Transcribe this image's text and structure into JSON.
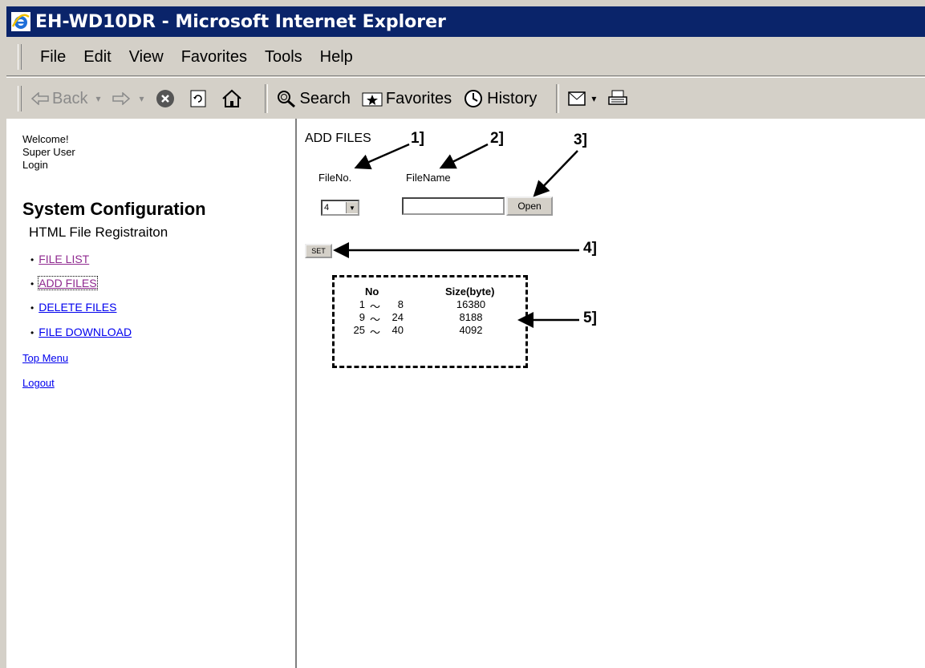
{
  "window": {
    "title": "EH-WD10DR - Microsoft Internet Explorer",
    "icon": "ie-logo-icon"
  },
  "menubar": {
    "items": [
      "File",
      "Edit",
      "View",
      "Favorites",
      "Tools",
      "Help"
    ]
  },
  "toolbar": {
    "back_label": "Back",
    "search_label": "Search",
    "favorites_label": "Favorites",
    "history_label": "History"
  },
  "sidebar": {
    "welcome": "Welcome!",
    "user": "Super User",
    "login": "Login",
    "heading": "System Configuration",
    "subheading": "HTML File Registraiton",
    "links": [
      "FILE LIST",
      "ADD FILES",
      "DELETE FILES",
      "FILE DOWNLOAD"
    ],
    "top_menu": "Top Menu",
    "logout": "Logout"
  },
  "main": {
    "header": "ADD FILES",
    "fileno_label": "FileNo.",
    "filename_label": "FileName",
    "fileno_value": "4",
    "filename_value": "",
    "open_button": "Open",
    "set_button": "SET",
    "table": {
      "headers": [
        "No",
        "Size(byte)"
      ],
      "rows": [
        {
          "from": "1",
          "sep": "〜",
          "to": "8",
          "size": "16380"
        },
        {
          "from": "9",
          "sep": "〜",
          "to": "24",
          "size": "8188"
        },
        {
          "from": "25",
          "sep": "〜",
          "to": "40",
          "size": "4092"
        }
      ]
    }
  },
  "callouts": [
    "1]",
    "2]",
    "3]",
    "4]",
    "5]"
  ]
}
